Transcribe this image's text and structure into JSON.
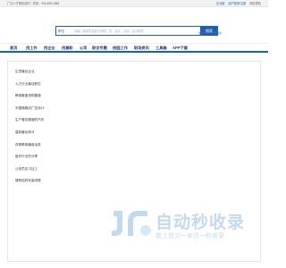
{
  "topbar": {
    "left_text": "广元人才网欢迎你！热线：400-838-1888",
    "right_links": [
      {
        "label": "企业版",
        "highlight": true
      },
      {
        "label": "用户登录/注册",
        "highlight": false
      },
      {
        "label": "网站导航",
        "highlight": false
      }
    ]
  },
  "search": {
    "type_label": "职位",
    "placeholder": "请输入搜索的关键字/类别，如：会计、出纳、会计助理",
    "button_label": "搜索"
  },
  "header_links": [
    "职位搜索",
    "简历搜索"
  ],
  "nav": {
    "items": [
      "首页",
      "找工作",
      "找企业",
      "找兼职",
      "公司",
      "职位专题",
      "校园工作",
      "职场资讯",
      "工具箱",
      "APP下载"
    ]
  },
  "list": {
    "items": [
      "生意最佳企业",
      "人力行业最佳职位",
      "教育集团采购渠道",
      "天猫旗舰店广告设计",
      "生产管控渠道的汽车",
      "高校最优奇才",
      "改革教育最新活跃",
      "医疗行业的分享",
      "公务员实习社工",
      "建筑结构安装流程"
    ]
  },
  "watermark": {
    "title": "自动秒收录",
    "subtitle": "数上提交一来访一秒收录"
  },
  "colors": {
    "brand": "#1a5fb4",
    "watermark": "#2a7abf"
  }
}
